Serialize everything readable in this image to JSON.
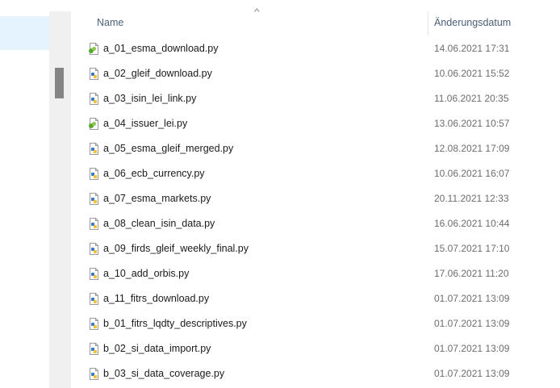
{
  "columns": {
    "name_label": "Name",
    "date_label": "Änderungsdatum"
  },
  "colors": {
    "header_text": "#4c607a",
    "selection": "#e5f3ff",
    "script_icon": "#3a78c7",
    "linked_icon": "#5aa830"
  },
  "files": [
    {
      "name": "a_01_esma_download.py",
      "date": "14.06.2021 17:31",
      "icon": "python-linked-file-icon"
    },
    {
      "name": "a_02_gleif_download.py",
      "date": "10.06.2021 15:52",
      "icon": "python-file-icon"
    },
    {
      "name": "a_03_isin_lei_link.py",
      "date": "11.06.2021 20:35",
      "icon": "python-file-icon"
    },
    {
      "name": "a_04_issuer_lei.py",
      "date": "13.06.2021 10:57",
      "icon": "python-linked-file-icon"
    },
    {
      "name": "a_05_esma_gleif_merged.py",
      "date": "12.08.2021 17:09",
      "icon": "python-file-icon"
    },
    {
      "name": "a_06_ecb_currency.py",
      "date": "10.06.2021 16:07",
      "icon": "python-file-icon"
    },
    {
      "name": "a_07_esma_markets.py",
      "date": "20.11.2021 12:33",
      "icon": "python-file-icon"
    },
    {
      "name": "a_08_clean_isin_data.py",
      "date": "16.06.2021 10:44",
      "icon": "python-file-icon"
    },
    {
      "name": "a_09_firds_gleif_weekly_final.py",
      "date": "15.07.2021 17:10",
      "icon": "python-file-icon"
    },
    {
      "name": "a_10_add_orbis.py",
      "date": "17.06.2021 11:20",
      "icon": "python-file-icon"
    },
    {
      "name": "a_11_fitrs_download.py",
      "date": "01.07.2021 13:09",
      "icon": "python-file-icon"
    },
    {
      "name": "b_01_fitrs_lqdty_descriptives.py",
      "date": "01.07.2021 13:09",
      "icon": "python-file-icon"
    },
    {
      "name": "b_02_si_data_import.py",
      "date": "01.07.2021 13:09",
      "icon": "python-file-icon"
    },
    {
      "name": "b_03_si_data_coverage.py",
      "date": "01.07.2021 13:09",
      "icon": "python-file-icon"
    }
  ]
}
